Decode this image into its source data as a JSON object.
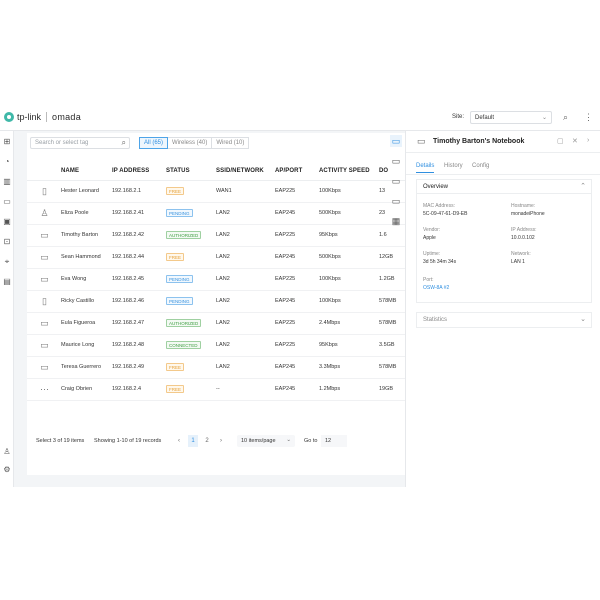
{
  "header": {
    "brand": "tp-link",
    "product": "omada",
    "site_label": "Site:",
    "site_value": "Default",
    "icons": [
      "search-icon",
      "more-icon"
    ]
  },
  "sidenav": {
    "icons": [
      "dashboard-icon",
      "statistics-icon",
      "map-icon",
      "devices-icon",
      "clients-icon",
      "insight-icon",
      "location-icon",
      "log-icon",
      "account-icon",
      "settings-icon"
    ]
  },
  "list": {
    "search_placeholder": "Search or select tag",
    "filters": [
      {
        "label": "All (65)",
        "active": true
      },
      {
        "label": "Wireless (40)",
        "active": false
      },
      {
        "label": "Wired (10)",
        "active": false
      }
    ],
    "columns": [
      "NAME",
      "IP ADDRESS",
      "STATUS",
      "SSID/NETWORK",
      "AP/PORT",
      "ACTIVITY SPEED",
      "DO"
    ],
    "rows": [
      {
        "icon": "tablet-icon",
        "name": "Hester Leonard",
        "ip": "192.168.2.1",
        "status": "FREE",
        "status_type": "free",
        "ssid": "WAN1",
        "ap": "EAP225",
        "speed": "100Kbps",
        "down": "13"
      },
      {
        "icon": "person-icon",
        "name": "Eliza Poole",
        "ip": "192.168.2.41",
        "status": "PENDING",
        "status_type": "pending",
        "ssid": "LAN2",
        "ap": "EAP245",
        "speed": "500Kbps",
        "down": "23"
      },
      {
        "icon": "laptop-icon",
        "name": "Timothy Barton",
        "ip": "192.168.2.42",
        "status": "AUTHORIZED",
        "status_type": "authorized",
        "ssid": "LAN2",
        "ap": "EAP225",
        "speed": "95Kbps",
        "down": "1.6"
      },
      {
        "icon": "monitor-icon",
        "name": "Sean Hammond",
        "ip": "192.168.2.44",
        "status": "FREE",
        "status_type": "free",
        "ssid": "LAN2",
        "ap": "EAP245",
        "speed": "500Kbps",
        "down": "12GB"
      },
      {
        "icon": "monitor-icon",
        "name": "Eva Wong",
        "ip": "192.168.2.45",
        "status": "PENDING",
        "status_type": "pending",
        "ssid": "LAN2",
        "ap": "EAP225",
        "speed": "100Kbps",
        "down": "1.2GB"
      },
      {
        "icon": "phone-icon",
        "name": "Ricky Castillo",
        "ip": "192.168.2.46",
        "status": "PENDING",
        "status_type": "pending",
        "ssid": "LAN2",
        "ap": "EAP245",
        "speed": "100Kbps",
        "down": "578MB"
      },
      {
        "icon": "laptop-icon",
        "name": "Eula Figueroa",
        "ip": "192.168.2.47",
        "status": "AUTHORIZED",
        "status_type": "authorized",
        "ssid": "LAN2",
        "ap": "EAP225",
        "speed": "2.4Mbps",
        "down": "578MB"
      },
      {
        "icon": "monitor-icon",
        "name": "Maurice Long",
        "ip": "192.168.2.48",
        "status": "CONNECTED",
        "status_type": "connected",
        "ssid": "LAN2",
        "ap": "EAP225",
        "speed": "95Kbps",
        "down": "3.5GB"
      },
      {
        "icon": "monitor-icon",
        "name": "Teresa Guerrero",
        "ip": "192.168.2.49",
        "status": "FREE",
        "status_type": "free",
        "ssid": "LAN2",
        "ap": "EAP245",
        "speed": "3.3Mbps",
        "down": "578MB"
      },
      {
        "icon": "other-device-icon",
        "name": "Craig Obrien",
        "ip": "192.168.2.4",
        "status": "FREE",
        "status_type": "free",
        "ssid": "--",
        "ap": "EAP245",
        "speed": "1.2Mbps",
        "down": "19GB"
      }
    ],
    "pager": {
      "selected": "Select 3 of 19 items",
      "showing": "Showing 1-10 of 19 records",
      "prev": "‹",
      "pages": [
        "1",
        "2"
      ],
      "next": "›",
      "per_page": "10 items/page",
      "goto_label": "Go to",
      "goto_value": "12"
    }
  },
  "detail": {
    "title": "Timothy Barton's Notebook",
    "tabs": [
      "Details",
      "History",
      "Config"
    ],
    "overview_title": "Overview",
    "fields": [
      {
        "key": "MAC Address:",
        "value": "5C-09-47-61-D9-EB",
        "link": false
      },
      {
        "key": "Hostname:",
        "value": "monadeiPhone",
        "link": false
      },
      {
        "key": "Vendor:",
        "value": "Apple",
        "link": false
      },
      {
        "key": "IP Address:",
        "value": "10.0.0.102",
        "link": false
      },
      {
        "key": "Uptime:",
        "value": "3d 5h 34m 34s",
        "link": false
      },
      {
        "key": "Network:",
        "value": "LAN 1",
        "link": false
      },
      {
        "key": "Port:",
        "value": "OSW-8A #2",
        "link": true
      }
    ],
    "statistics_title": "Statistics"
  },
  "colors": {
    "accent": "#2f8fe0",
    "free": "#e6a23c",
    "pending": "#3a93de",
    "authorized": "#43a047"
  }
}
